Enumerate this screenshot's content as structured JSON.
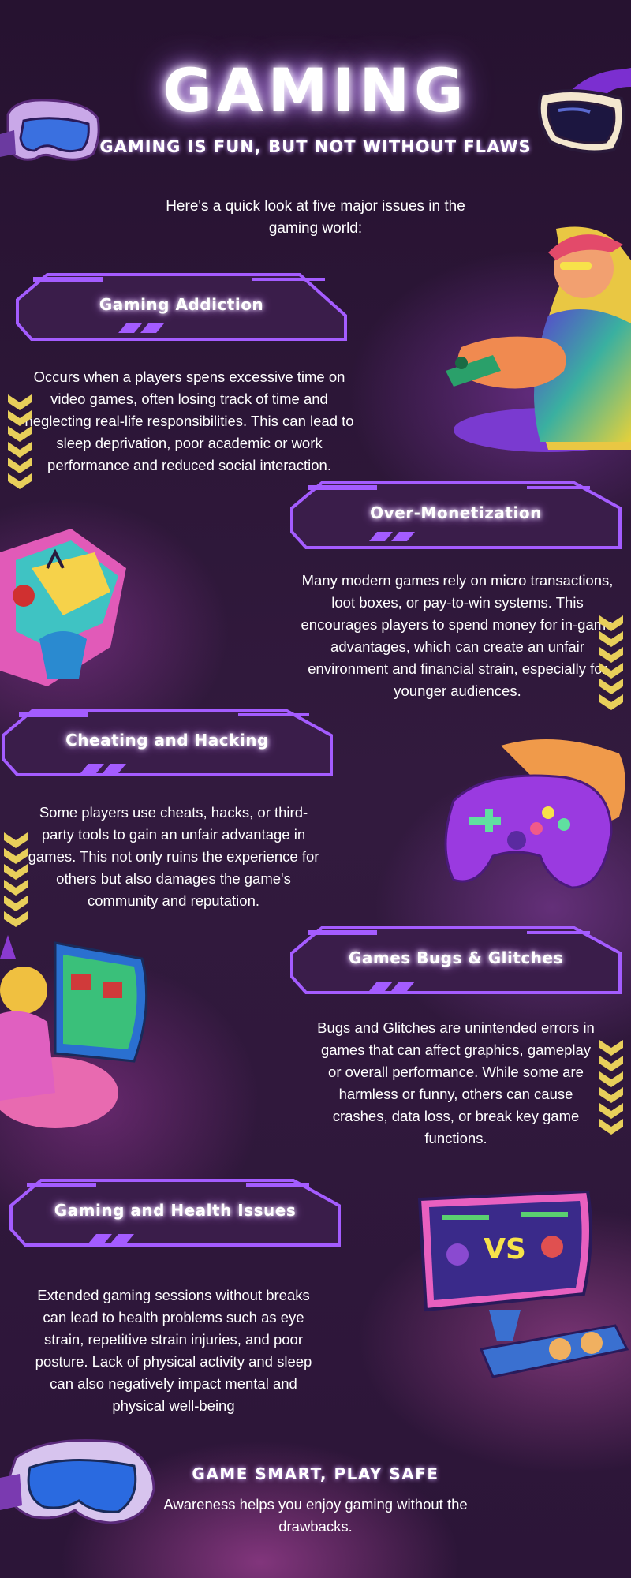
{
  "header": {
    "title": "GAMING",
    "subtitle": "Gaming is fun, but not without flaws",
    "intro": "Here's a quick look at five major issues in the gaming world:"
  },
  "sections": [
    {
      "heading": "Gaming Addiction",
      "body": "Occurs when a players spens excessive time on video games, often losing track of time and neglecting real-life responsibilities. This can lead to sleep deprivation, poor academic or work performance and reduced social interaction."
    },
    {
      "heading": "Over-Monetization",
      "body": "Many modern games rely on micro transactions, loot boxes, or pay-to-win systems. This encourages players to spend money for in-game advantages, which can create an unfair environment and financial strain, especially for younger audiences."
    },
    {
      "heading": "Cheating and Hacking",
      "body": "Some players use cheats, hacks, or third-party tools to gain an unfair advantage in games. This not only ruins the experience for others but also damages the game's community and reputation."
    },
    {
      "heading": "Games Bugs & Glitches",
      "body": "Bugs and Glitches are unintended errors in games that can affect graphics, gameplay or overall performance. While some are harmless or funny, others can cause crashes, data loss, or break key game functions."
    },
    {
      "heading": "Gaming and Health Issues",
      "body": "Extended gaming sessions without breaks can lead to health problems such as eye strain, repetitive strain injuries, and poor posture. Lack of physical activity and sleep can also negatively impact mental and physical well-being"
    }
  ],
  "footer": {
    "title": "Game smart, play safe",
    "text": "Awareness helps you enjoy gaming without the drawbacks."
  },
  "colors": {
    "background": "#2a1633",
    "neon_purple": "#a45cff",
    "box_fill": "#3a1d4a",
    "chevron_yellow": "#e8cf5a"
  },
  "icons": [
    "vr-headset-icon",
    "gamer-character-icon",
    "arcade-machine-icon",
    "game-controller-icon",
    "retro-arcade-player-icon",
    "game-monitor-icon"
  ]
}
